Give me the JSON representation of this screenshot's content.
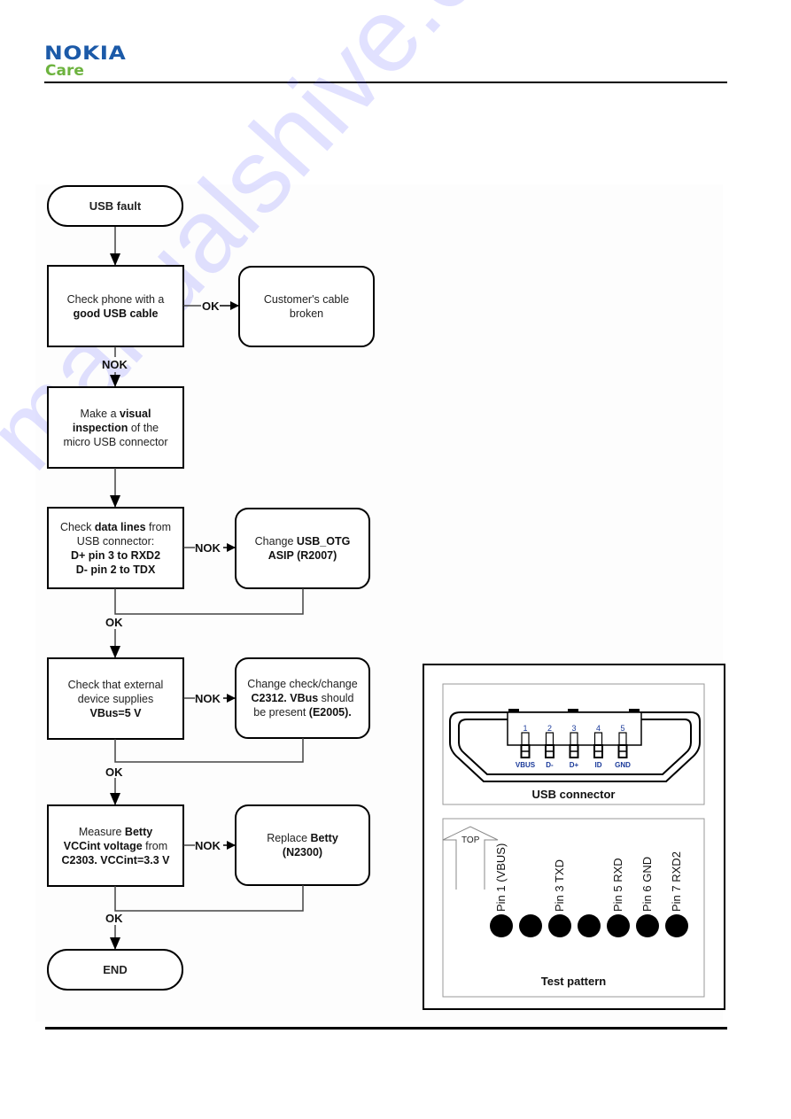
{
  "header": {
    "brand": "NOKIA",
    "subbrand": "Care",
    "brand_color": "#1c5aa8",
    "subbrand_color": "#6db33f"
  },
  "watermark": "manualshive.com",
  "flowchart": {
    "start": "USB fault",
    "end": "END",
    "steps": [
      {
        "check": [
          "Check phone with a",
          "good USB cable"
        ],
        "check_bold": [
          false,
          true
        ],
        "branch_label": "OK",
        "action": [
          "Customer's cable",
          "broken"
        ],
        "continue_label": "NOK"
      },
      {
        "check": [
          "Make a ",
          "visual",
          "inspection",
          " of the",
          "micro USB connector"
        ]
      },
      {
        "check": [
          "Check ",
          "data lines",
          " from",
          "USB connector:",
          "D+ pin 3  to RXD2",
          "D- pin 2 to TDX"
        ],
        "branch_label": "NOK",
        "action": [
          "Change ",
          "USB_OTG",
          "ASIP (R2007)"
        ],
        "continue_label": "OK"
      },
      {
        "check": [
          "Check that external",
          "device supplies",
          "VBus=5 V"
        ],
        "branch_label": "NOK",
        "action": [
          "Change check/change",
          "C2312. VBus",
          " should",
          "be present ",
          "(E2005)."
        ],
        "continue_label": "OK"
      },
      {
        "check": [
          "Measure ",
          "Betty",
          "VCCint voltage",
          " from",
          "C2303. VCCint=3.3 V"
        ],
        "branch_label": "NOK",
        "action": [
          "Replace ",
          "Betty",
          "(N2300)"
        ],
        "continue_label": "OK"
      }
    ]
  },
  "usb_connector": {
    "caption": "USB connector",
    "pins": [
      {
        "number": "1",
        "name": "VBUS"
      },
      {
        "number": "2",
        "name": "D-"
      },
      {
        "number": "3",
        "name": "D+"
      },
      {
        "number": "4",
        "name": "ID"
      },
      {
        "number": "5",
        "name": "GND"
      }
    ],
    "pin_label_color": "#1a3a9a"
  },
  "test_pattern": {
    "caption": "Test pattern",
    "orientation_label": "TOP",
    "pad_labels": [
      "Pin 1 (VBUS)",
      "",
      "Pin 3 TXD",
      "",
      "Pin 5 RXD",
      "Pin 6 GND",
      "Pin 7 RXD2"
    ],
    "pad_count": 7
  }
}
